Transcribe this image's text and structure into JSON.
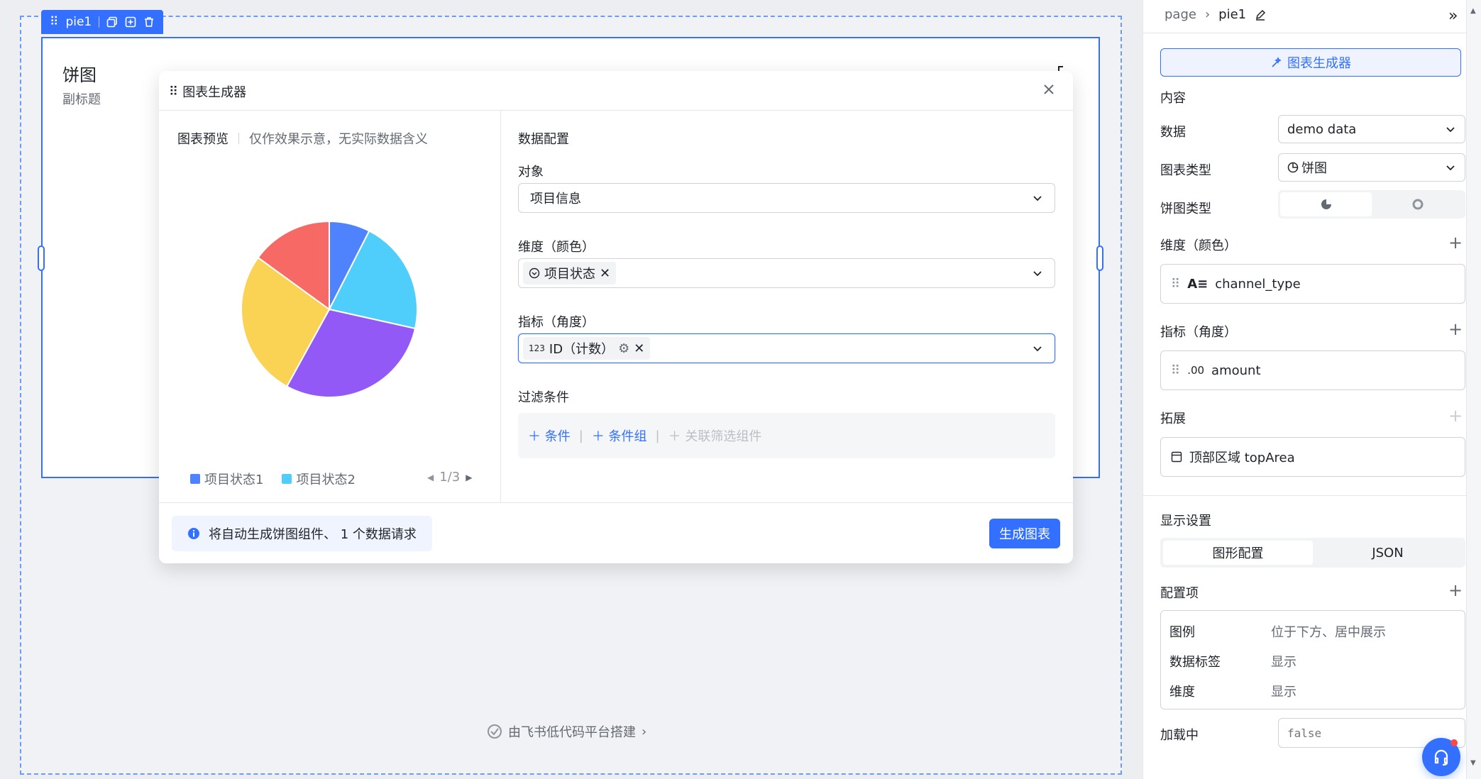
{
  "canvas": {
    "selection_tag": "pie1",
    "card_title": "饼图",
    "card_subtitle": "副标题",
    "footer_brand": "由飞书低代码平台搭建"
  },
  "modal": {
    "title": "图表生成器",
    "preview": {
      "title": "图表预览",
      "note": "仅作效果示意，无实际数据含义",
      "legend": [
        {
          "label": "项目状态1",
          "color": "#4e83fd"
        },
        {
          "label": "项目状态2",
          "color": "#50cefb"
        }
      ],
      "legend_pager": "1/3"
    },
    "config": {
      "section_title": "数据配置",
      "object_label": "对象",
      "object_value": "项目信息",
      "dimension_label": "维度（颜色）",
      "dimension_chip": "项目状态",
      "metric_label": "指标（角度）",
      "metric_prefix": "123",
      "metric_chip": "ID（计数）",
      "filter_label": "过滤条件",
      "filter_condition": "条件",
      "filter_group": "条件组",
      "filter_linked": "关联筛选组件"
    },
    "footer": {
      "info": "将自动生成饼图组件、 1 个数据请求",
      "generate_button": "生成图表"
    }
  },
  "chart_data": {
    "type": "pie",
    "title": "",
    "slices": [
      {
        "value": 7.5,
        "color": "#4e83fd"
      },
      {
        "value": 21,
        "color": "#50cefb"
      },
      {
        "value": 29.5,
        "color": "#9259f7"
      },
      {
        "value": 27,
        "color": "#fad354"
      },
      {
        "value": 15,
        "color": "#f76964"
      }
    ]
  },
  "right_panel": {
    "breadcrumb_root": "page",
    "breadcrumb_current": "pie1",
    "chart_builder_button": "图表生成器",
    "section_content": "内容",
    "data_label": "数据",
    "data_value": "demo data",
    "chart_type_label": "图表类型",
    "chart_type_value": "饼图",
    "pie_type_label": "饼图类型",
    "dimension_label": "维度（颜色）",
    "dimension_field": "channel_type",
    "metric_label": "指标（角度）",
    "metric_field": "amount",
    "metric_field_prefix": ".00",
    "extend_label": "拓展",
    "extend_value": "顶部区域 topArea",
    "display_label": "显示设置",
    "tab_graphic": "图形配置",
    "tab_json": "JSON",
    "config_items_label": "配置项",
    "config_rows": [
      {
        "key": "图例",
        "value": "位于下方、居中展示"
      },
      {
        "key": "数据标签",
        "value": "显示"
      },
      {
        "key": "维度",
        "value": "显示"
      }
    ],
    "loading_label": "加载中",
    "loading_value": "false"
  },
  "colors": {
    "accent": "#3370ff",
    "pie": [
      "#4e83fd",
      "#50cefb",
      "#9259f7",
      "#fad354",
      "#f76964"
    ]
  }
}
